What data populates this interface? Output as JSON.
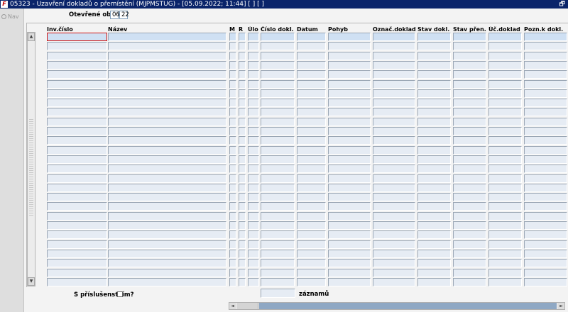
{
  "window": {
    "app_icon": "F",
    "title": "05323 - Uzavření dokladů o přemístění (MJPMSTUG) - [05.09.2022; 11:44]  [ ]  [ ]",
    "restore_glyph": "🗗"
  },
  "sidebar": {
    "nav_label": "Nav",
    "nav_icon": "nav-circle-icon"
  },
  "period": {
    "label": "Otevřené období",
    "month": "06",
    "year": "22"
  },
  "table": {
    "columns": [
      {
        "key": "inv",
        "label": "Inv.číslo"
      },
      {
        "key": "nazev",
        "label": "Název"
      },
      {
        "key": "m",
        "label": "M"
      },
      {
        "key": "r",
        "label": "R"
      },
      {
        "key": "ulo",
        "label": "Úlo"
      },
      {
        "key": "cislo",
        "label": "Číslo dokl."
      },
      {
        "key": "datum",
        "label": "Datum"
      },
      {
        "key": "pohyb",
        "label": "Pohyb"
      },
      {
        "key": "oznac",
        "label": "Označ.dokladu"
      },
      {
        "key": "stav_dokl",
        "label": "Stav dokl."
      },
      {
        "key": "stav_pren",
        "label": "Stav přen."
      },
      {
        "key": "uc_doklad",
        "label": "Úč.doklad"
      },
      {
        "key": "pozn",
        "label": "Pozn.k dokl."
      }
    ],
    "row_count": 27,
    "scroll_up_glyph": "▲",
    "scroll_down_glyph": "▼"
  },
  "footer": {
    "accessories_label": "S příslušenstvím?",
    "accessories_checked": false,
    "count_value": "",
    "count_label": "záznamů",
    "hscroll_left_glyph": "◄",
    "hscroll_right_glyph": "►"
  }
}
